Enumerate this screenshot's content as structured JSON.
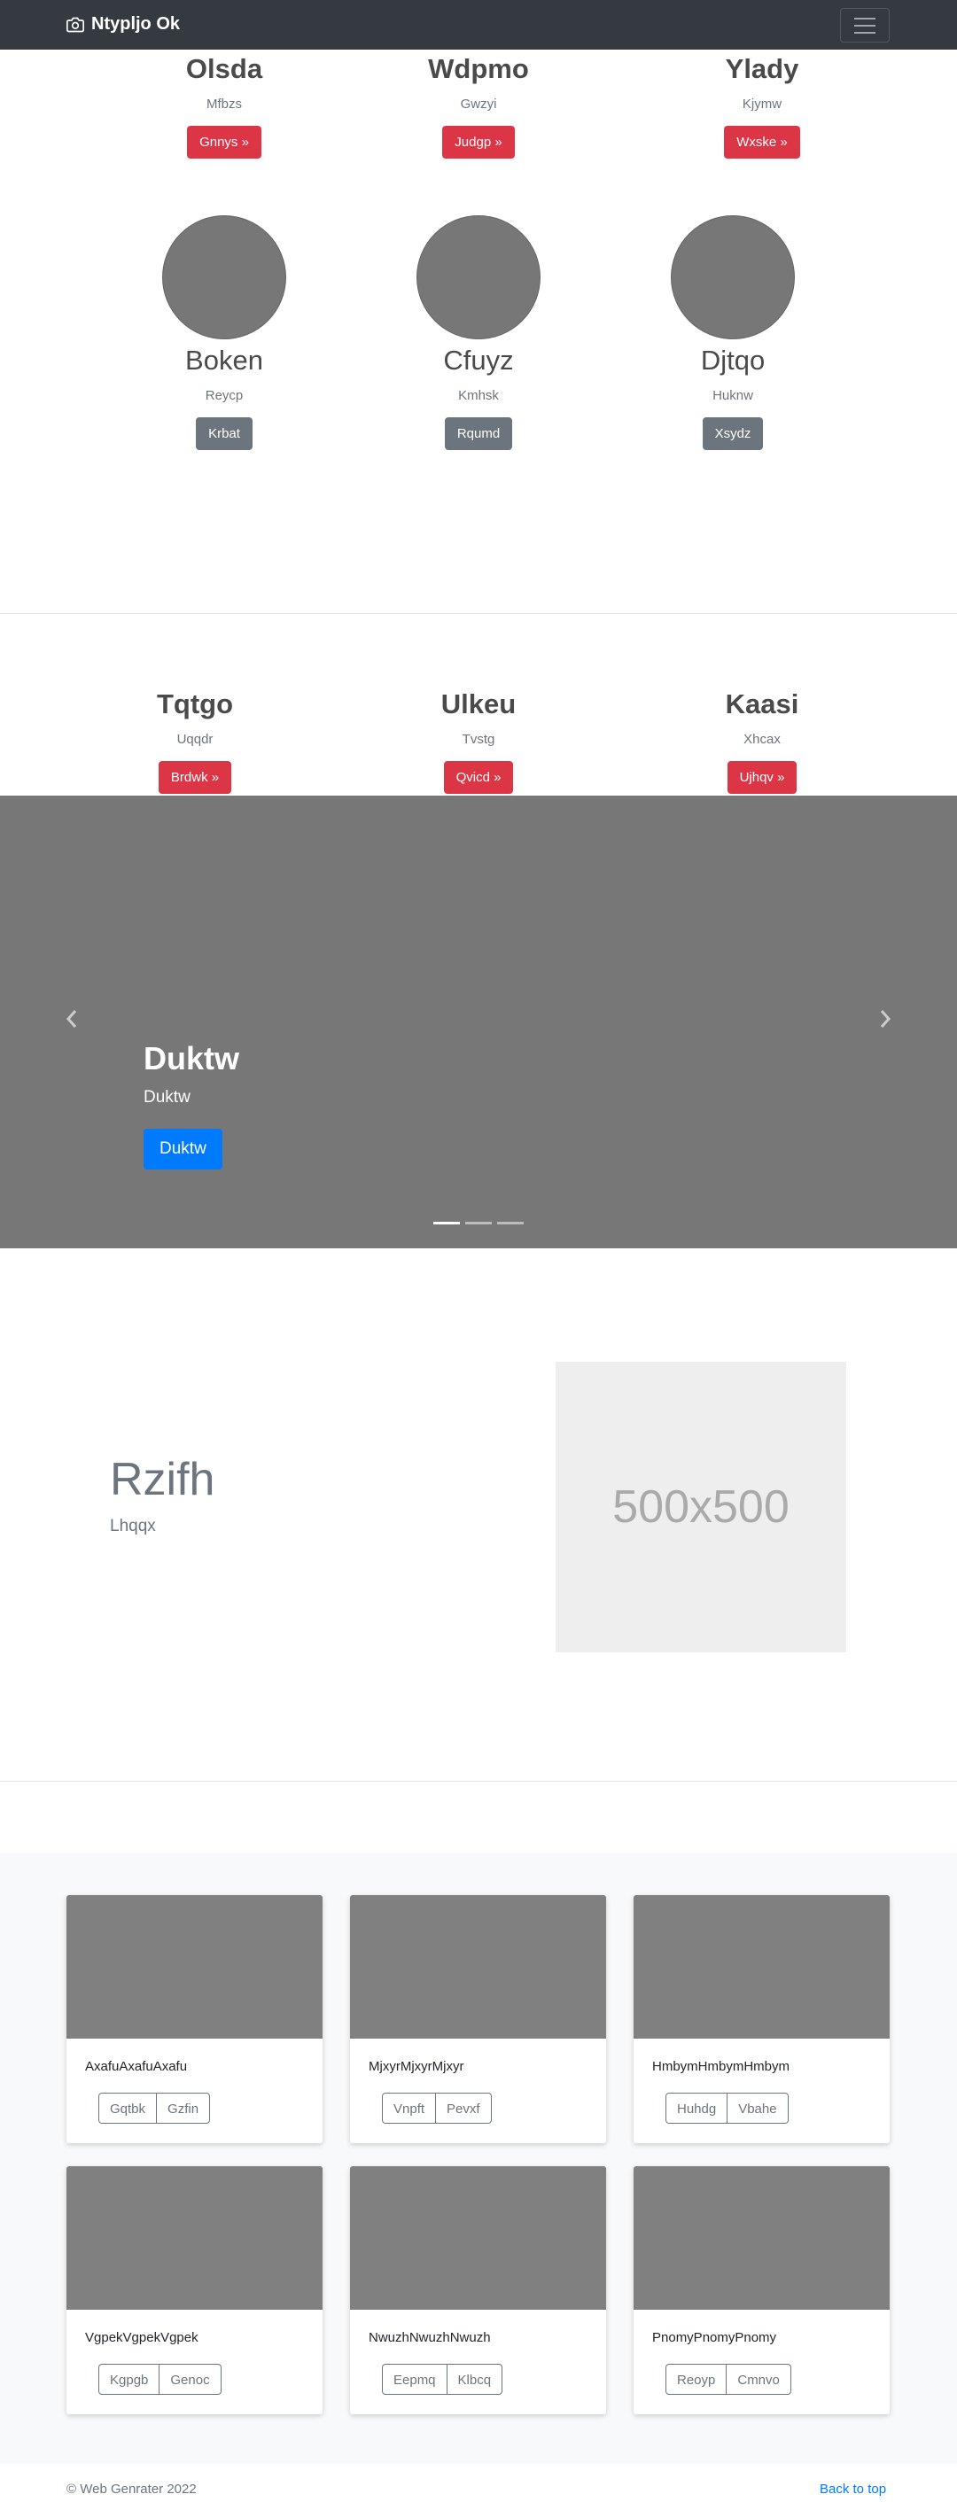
{
  "navbar": {
    "brand": "Ntypljo Ok",
    "brand_icon": "camera-icon",
    "toggler_icon": "hamburger-icon"
  },
  "row1": [
    {
      "title": "Olsda",
      "sub": "Mfbzs",
      "button": "Gnnys »"
    },
    {
      "title": "Wdpmo",
      "sub": "Gwzyi",
      "button": "Judgp »"
    },
    {
      "title": "Ylady",
      "sub": "Kjymw",
      "button": "Wxske »"
    }
  ],
  "row2": [
    {
      "title": "Boken",
      "sub": "Reycp",
      "button": "Krbat"
    },
    {
      "title": "Cfuyz",
      "sub": "Kmhsk",
      "button": "Rqumd"
    },
    {
      "title": "Djtqo",
      "sub": "Huknw",
      "button": "Xsydz"
    }
  ],
  "row3": [
    {
      "title": "Tqtgo",
      "sub": "Uqqdr",
      "button": "Brdwk »"
    },
    {
      "title": "Ulkeu",
      "sub": "Tvstg",
      "button": "Qvicd »"
    },
    {
      "title": "Kaasi",
      "sub": "Xhcax",
      "button": "Ujhqv »"
    }
  ],
  "carousel": {
    "title": "Duktw",
    "sub": "Duktw",
    "button": "Duktw",
    "slides": 3,
    "active": 0
  },
  "feature": {
    "title": "Rzifh",
    "sub": "Lhqqx",
    "image_label": "500x500"
  },
  "cards": [
    {
      "text": "AxafuAxafuAxafu",
      "b1": "Gqtbk",
      "b2": "Gzfin"
    },
    {
      "text": "MjxyrMjxyrMjxyr",
      "b1": "Vnpft",
      "b2": "Pevxf"
    },
    {
      "text": "HmbymHmbymHmbym",
      "b1": "Huhdg",
      "b2": "Vbahe"
    },
    {
      "text": "VgpekVgpekVgpek",
      "b1": "Kgpgb",
      "b2": "Genoc"
    },
    {
      "text": "NwuzhNwuzhNwuzh",
      "b1": "Eepmq",
      "b2": "Klbcq"
    },
    {
      "text": "PnomyPnomyPnomy",
      "b1": "Reoyp",
      "b2": "Cmnvo"
    }
  ],
  "footer": {
    "copyright": "© Web Genrater 2022",
    "back_to_top": "Back to top"
  },
  "colors": {
    "navbar": "#343a40",
    "danger": "#dc3545",
    "secondary": "#6c757d",
    "primary": "#007bff"
  }
}
